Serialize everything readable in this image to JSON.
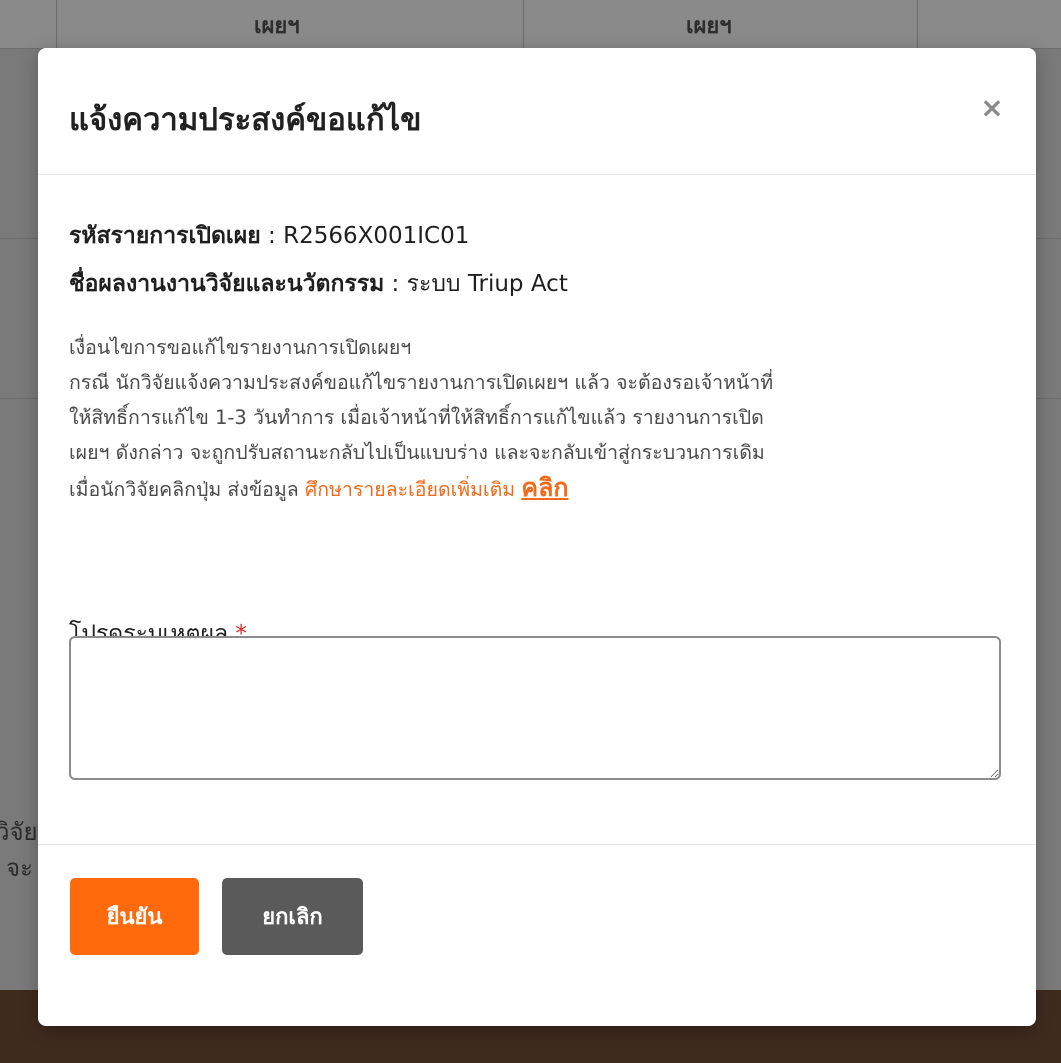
{
  "background": {
    "header_cells": [
      "เผยฯ",
      "เผยฯ"
    ],
    "side_texts": [
      "วิจัย",
      "จะ"
    ]
  },
  "modal": {
    "title": "แจ้งความประสงค์ขอแก้ไข",
    "close_symbol": "×",
    "code_label": "รหัสรายการเปิดเผย",
    "code_sep": " : ",
    "code_value": "R2566X001IC01",
    "work_label": "ชื่อผลงานงานวิจัยและนวัตกรรม",
    "work_sep": " : ",
    "work_value": "ระบบ Triup Act",
    "condition_lines": [
      "เงื่อนไขการขอแก้ไขรายงานการเปิดเผยฯ",
      "กรณี นักวิจัยแจ้งความประสงค์ขอแก้ไขรายงานการเปิดเผยฯ แล้ว จะต้องรอเจ้าหน้าที่",
      "ให้สิทธิ์การแก้ไข 1-3 วันทำการ เมื่อเจ้าหน้าที่ให้สิทธิ์การแก้ไขแล้ว รายงานการเปิด",
      "เผยฯ ดังกล่าว จะถูกปรับสถานะกลับไปเป็นแบบร่าง และจะกลับเข้าสู่กระบวนการเดิม",
      "เมื่อนักวิจัยคลิกปุ่ม ส่งข้อมูล "
    ],
    "more_info_text": "ศึกษารายละเอียดเพิ่มเติม",
    "click_link_text": "คลิก",
    "reason_label": "โปรดระบุเหตุผล",
    "required_mark": "*",
    "reason_value": "",
    "confirm_label": "ยืนยัน",
    "cancel_label": "ยกเลิก"
  },
  "colors": {
    "accent": "#ff6a0c",
    "cancel": "#5a5a5a",
    "link": "#f26a1b",
    "required": "#e02424"
  }
}
